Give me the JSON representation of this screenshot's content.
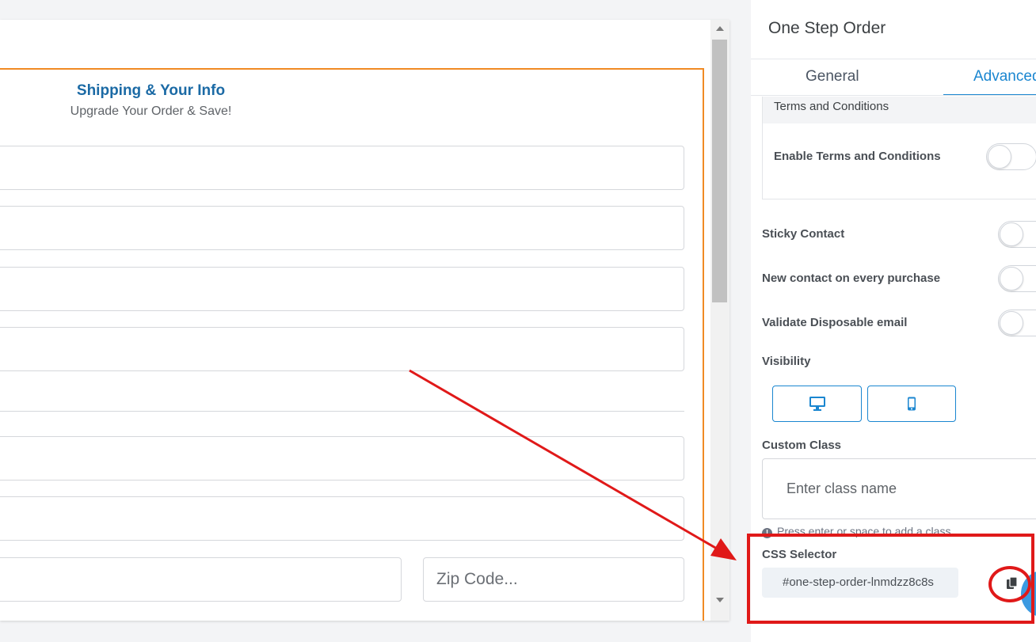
{
  "canvas": {
    "form_title": "Shipping & Your Info",
    "form_subtitle": "Upgrade Your Order & Save!",
    "zip_placeholder": "Zip Code..."
  },
  "panel": {
    "title": "One Step Order",
    "tabs": [
      {
        "label": "General",
        "active": false
      },
      {
        "label": "Advanced",
        "active": true
      }
    ],
    "terms_section": {
      "header": "Terms and Conditions",
      "enable_label": "Enable Terms and Conditions",
      "enabled": false
    },
    "toggles": [
      {
        "label": "Sticky Contact",
        "enabled": false
      },
      {
        "label": "New contact on every purchase",
        "enabled": false
      },
      {
        "label": "Validate Disposable email",
        "enabled": false
      }
    ],
    "visibility": {
      "label": "Visibility",
      "options": [
        {
          "icon": "desktop-icon"
        },
        {
          "icon": "mobile-icon"
        }
      ]
    },
    "custom_class": {
      "label": "Custom Class",
      "placeholder": "Enter class name",
      "hint": "Press enter or space to add a class"
    },
    "css_selector": {
      "label": "CSS Selector",
      "value": "#one-step-order-lnmdzz8c8s"
    }
  },
  "colors": {
    "accent": "#1a86d0",
    "form_border": "#f08a24",
    "annotation": "#e01919"
  }
}
